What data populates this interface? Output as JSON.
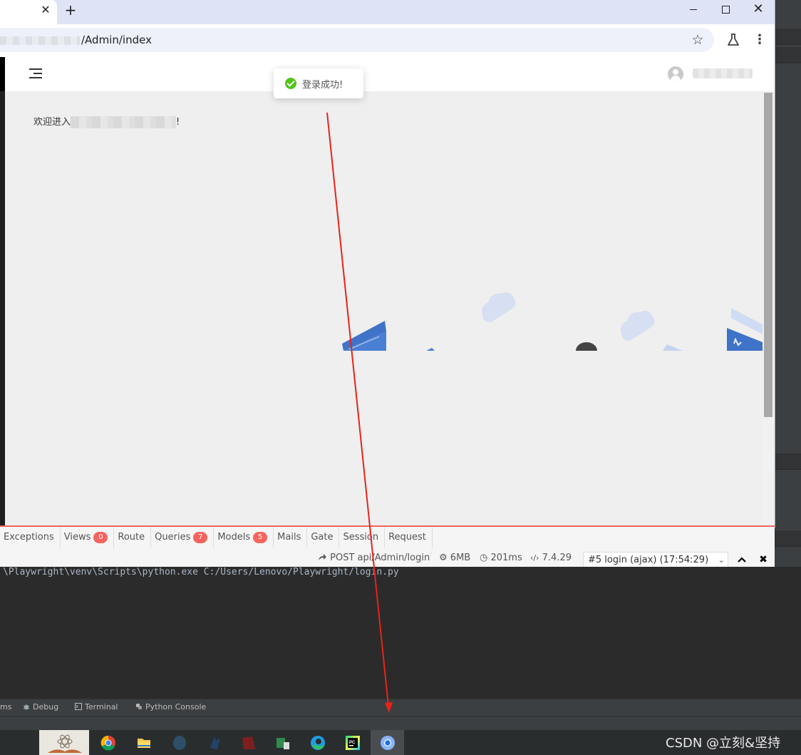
{
  "browser": {
    "tab_close_glyph": "✕",
    "new_tab_glyph": "+",
    "window_controls": {
      "close_glyph": "✕"
    },
    "url_visible": "/Admin/index",
    "star_glyph": "☆",
    "menu_glyph": "⋮"
  },
  "page": {
    "toast_text": "登录成功!",
    "welcome_prefix": "欢迎进入",
    "welcome_suffix": "!"
  },
  "debugbar": {
    "tabs": [
      {
        "label": "Exceptions",
        "badge": null
      },
      {
        "label": "Views",
        "badge": "0"
      },
      {
        "label": "Route",
        "badge": null
      },
      {
        "label": "Queries",
        "badge": "7"
      },
      {
        "label": "Models",
        "badge": "5"
      },
      {
        "label": "Mails",
        "badge": null
      },
      {
        "label": "Gate",
        "badge": null
      },
      {
        "label": "Session",
        "badge": null
      },
      {
        "label": "Request",
        "badge": null
      }
    ],
    "request": "POST api/Admin/login",
    "memory": "6MB",
    "time": "201ms",
    "php_version": "7.4.29",
    "selected_request": "#5 login (ajax) (17:54:29)"
  },
  "console": {
    "line": "\\Playwright\\venv\\Scripts\\python.exe C:/Users/Lenovo/Playwright/login.py"
  },
  "ide_tabs": {
    "partial": "ms",
    "debug": "Debug",
    "terminal": "Terminal",
    "python_console": "Python Console"
  },
  "watermark": "CSDN @立刻&坚持",
  "colors": {
    "debug_accent": "#f4645f",
    "success": "#52c41a",
    "annotation_arrow": "#e8231a"
  },
  "icons": [
    "tab-close-icon",
    "new-tab-icon",
    "star-icon",
    "labs-flask-icon",
    "kebab-menu-icon",
    "hamburger-icon",
    "avatar-icon",
    "success-check-icon",
    "share-icon",
    "memory-icon",
    "clock-icon",
    "code-icon",
    "chevron-up-icon",
    "close-icon",
    "bug-icon",
    "terminal-icon",
    "python-icon",
    "chrome-icon",
    "folder-icon",
    "edge-icon",
    "pycharm-icon"
  ]
}
